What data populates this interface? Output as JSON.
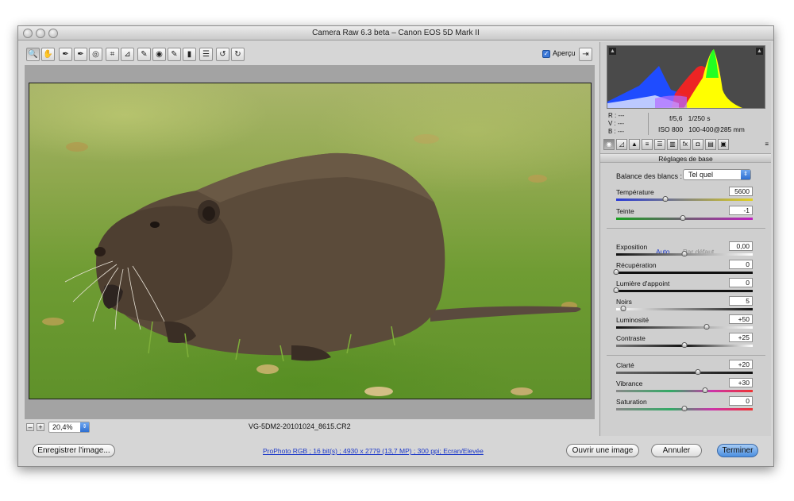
{
  "window": {
    "title": "Camera Raw 6.3 beta  –  Canon EOS 5D Mark II"
  },
  "toolbar": {
    "tools": [
      {
        "name": "zoom-tool",
        "glyph": "🔍"
      },
      {
        "name": "hand-tool",
        "glyph": "✋"
      },
      {
        "name": "white-balance-tool",
        "glyph": "✒"
      },
      {
        "name": "color-sampler-tool",
        "glyph": "✒"
      },
      {
        "name": "targeted-adjustment-tool",
        "glyph": "◎"
      },
      {
        "name": "crop-tool",
        "glyph": "⌗"
      },
      {
        "name": "straighten-tool",
        "glyph": "⊿"
      },
      {
        "name": "spot-removal-tool",
        "glyph": "✎"
      },
      {
        "name": "red-eye-tool",
        "glyph": "◉"
      },
      {
        "name": "adjustment-brush-tool",
        "glyph": "✎"
      },
      {
        "name": "graduated-filter-tool",
        "glyph": "▮"
      },
      {
        "name": "preferences-tool",
        "glyph": "☰"
      },
      {
        "name": "rotate-left-tool",
        "glyph": "↺"
      },
      {
        "name": "rotate-right-tool",
        "glyph": "↻"
      }
    ],
    "preview_label": "Aperçu",
    "preview_checked": true
  },
  "zoom": {
    "value": "20,4%",
    "minus": "–",
    "plus": "+"
  },
  "image": {
    "filename": "VG-5DM2-20101024_8615.CR2"
  },
  "bottom": {
    "save_label": "Enregistrer l'image...",
    "workflow_link": "ProPhoto RGB ; 16 bit(s) ; 4930 x 2779 (13,7 MP) ; 300 ppi; Ecran/Elevée",
    "open_label": "Ouvrir une image",
    "cancel_label": "Annuler",
    "done_label": "Terminer"
  },
  "info": {
    "r_label": "R :",
    "g_label": "V :",
    "b_label": "B :",
    "r_value": "---",
    "g_value": "---",
    "b_value": "---",
    "aperture": "f/5,6",
    "shutter": "1/250 s",
    "iso": "ISO 800",
    "lens": "100-400@285 mm"
  },
  "panel": {
    "section_title": "Réglages de base",
    "wb_label": "Balance des blancs :",
    "wb_value": "Tel quel",
    "auto_label": "Auto",
    "default_label": "Par défaut",
    "sliders": [
      {
        "key": "temperature",
        "label": "Température",
        "value": "5600",
        "pos": 0.36
      },
      {
        "key": "tint",
        "label": "Teinte",
        "value": "-1",
        "pos": 0.49
      },
      {
        "key": "exposure",
        "label": "Exposition",
        "value": "0,00",
        "pos": 0.5
      },
      {
        "key": "recovery",
        "label": "Récupération",
        "value": "0",
        "pos": 0.0
      },
      {
        "key": "fill-light",
        "label": "Lumière d'appoint",
        "value": "0",
        "pos": 0.0
      },
      {
        "key": "blacks",
        "label": "Noirs",
        "value": "5",
        "pos": 0.05
      },
      {
        "key": "brightness",
        "label": "Luminosité",
        "value": "+50",
        "pos": 0.66
      },
      {
        "key": "contrast",
        "label": "Contraste",
        "value": "+25",
        "pos": 0.5
      },
      {
        "key": "clarity",
        "label": "Clarté",
        "value": "+20",
        "pos": 0.6
      },
      {
        "key": "vibrance",
        "label": "Vibrance",
        "value": "+30",
        "pos": 0.65
      },
      {
        "key": "saturation",
        "label": "Saturation",
        "value": "0",
        "pos": 0.5
      }
    ],
    "tabs": [
      "basic",
      "tone-curve",
      "detail",
      "hsl",
      "split-toning",
      "lens-corrections",
      "effects",
      "camera-calibration",
      "presets",
      "snapshots"
    ]
  },
  "colors": {
    "accent_blue": "#3b78d8",
    "link_blue": "#1a36c8"
  }
}
